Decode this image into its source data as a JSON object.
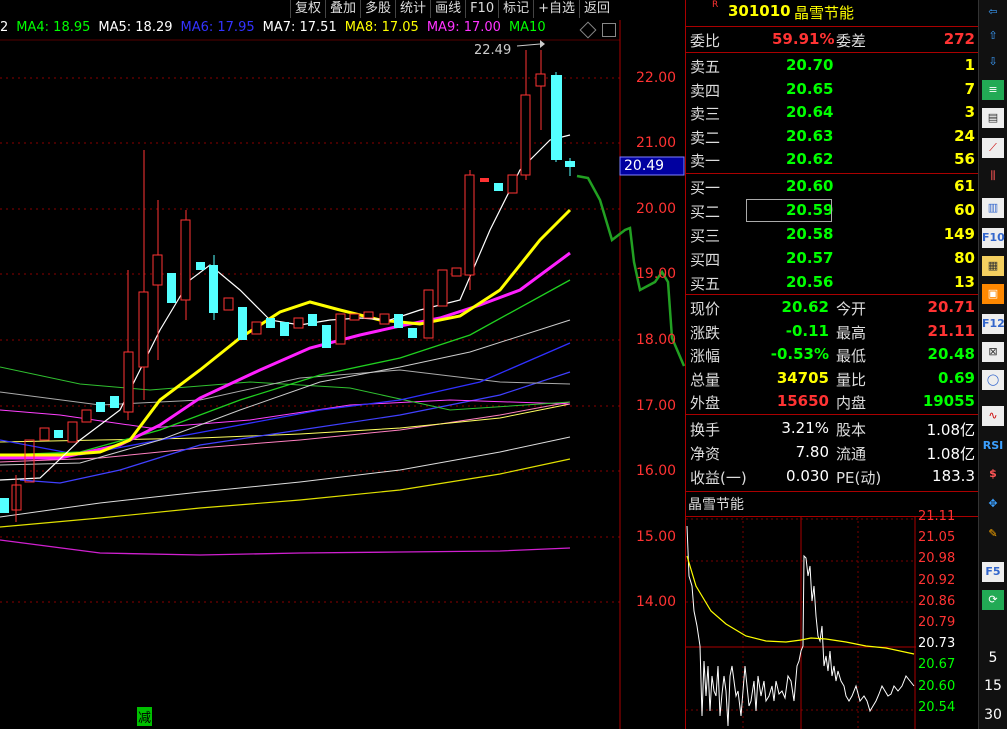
{
  "toolbar": [
    "复权",
    "叠加",
    "多股",
    "统计",
    "画线",
    "F10",
    "标记",
    "+自选",
    "返回"
  ],
  "ma_legend": [
    {
      "label": "2",
      "color": "#ffffff"
    },
    {
      "label": "MA4: 18.95",
      "color": "#00ff00"
    },
    {
      "label": "MA5: 18.29",
      "color": "#ffffff"
    },
    {
      "label": "MA6: 17.95",
      "color": "#3333ff"
    },
    {
      "label": "MA7: 17.51",
      "color": "#ffffff"
    },
    {
      "label": "MA8: 17.05",
      "color": "#ffff00"
    },
    {
      "label": "MA9: 17.00",
      "color": "#ff33ff"
    },
    {
      "label": "MA10",
      "color": "#00ff00"
    }
  ],
  "price_axis": [
    "22.00",
    "21.00",
    "20.00",
    "19.00",
    "18.00",
    "17.00",
    "16.00",
    "15.00",
    "14.00"
  ],
  "current_price_tag": "20.49",
  "peak_label": "22.49",
  "bottom_marker": "减",
  "stock": {
    "code": "301010",
    "name": "晶雪节能",
    "flag": "R"
  },
  "weibi": {
    "label": "委比",
    "value": "59.91%",
    "label2": "委差",
    "value2": "272"
  },
  "sell": [
    {
      "label": "卖五",
      "price": "20.70",
      "vol": "1"
    },
    {
      "label": "卖四",
      "price": "20.65",
      "vol": "7"
    },
    {
      "label": "卖三",
      "price": "20.64",
      "vol": "3"
    },
    {
      "label": "卖二",
      "price": "20.63",
      "vol": "24"
    },
    {
      "label": "卖一",
      "price": "20.62",
      "vol": "56"
    }
  ],
  "buy": [
    {
      "label": "买一",
      "price": "20.60",
      "vol": "61"
    },
    {
      "label": "买二",
      "price": "20.59",
      "vol": "60"
    },
    {
      "label": "买三",
      "price": "20.58",
      "vol": "149"
    },
    {
      "label": "买四",
      "price": "20.57",
      "vol": "80"
    },
    {
      "label": "买五",
      "price": "20.56",
      "vol": "13"
    }
  ],
  "stats": [
    {
      "l1": "现价",
      "v1": "20.62",
      "c1": "#00ff00",
      "l2": "今开",
      "v2": "20.71",
      "c2": "#ff3333"
    },
    {
      "l1": "涨跌",
      "v1": "-0.11",
      "c1": "#00ff00",
      "l2": "最高",
      "v2": "21.11",
      "c2": "#ff3333"
    },
    {
      "l1": "涨幅",
      "v1": "-0.53%",
      "c1": "#00ff00",
      "l2": "最低",
      "v2": "20.48",
      "c2": "#00ff00"
    },
    {
      "l1": "总量",
      "v1": "34705",
      "c1": "#ffff00",
      "l2": "量比",
      "v2": "0.69",
      "c2": "#00ff00"
    },
    {
      "l1": "外盘",
      "v1": "15650",
      "c1": "#ff3333",
      "l2": "内盘",
      "v2": "19055",
      "c2": "#00ff00"
    }
  ],
  "stats2": [
    {
      "l1": "换手",
      "v1": "3.21%",
      "l2": "股本",
      "v2": "1.08亿"
    },
    {
      "l1": "净资",
      "v1": "7.80",
      "l2": "流通",
      "v2": "1.08亿"
    },
    {
      "l1": "收益(一)",
      "v1": "0.030",
      "l2": "PE(动)",
      "v2": "183.3"
    }
  ],
  "minichart": {
    "title": "晶雪节能",
    "axis": [
      "21.11",
      "21.05",
      "20.98",
      "20.92",
      "20.86",
      "20.79",
      "20.73",
      "20.67",
      "20.60",
      "20.54"
    ],
    "axis_colors": [
      "#ff3333",
      "#ff3333",
      "#ff3333",
      "#ff3333",
      "#ff3333",
      "#ff3333",
      "#ffffff",
      "#00ff00",
      "#00ff00",
      "#00ff00"
    ]
  },
  "iconbar": [
    "RSI",
    "F5",
    "5",
    "15",
    "30"
  ]
}
